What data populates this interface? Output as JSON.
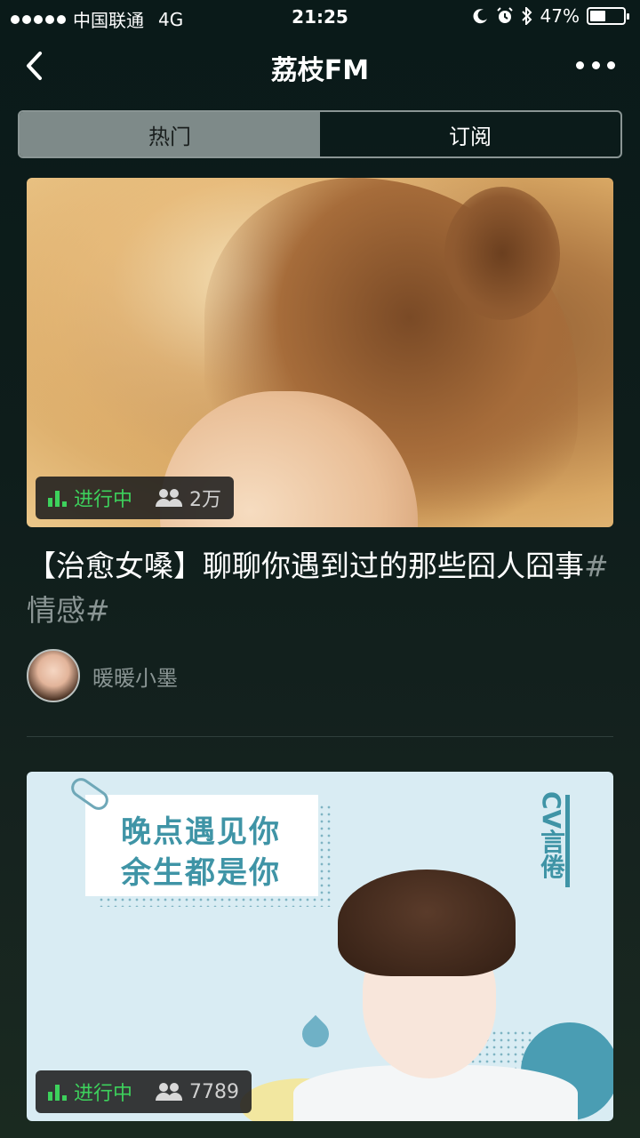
{
  "status_bar": {
    "carrier": "中国联通",
    "network": "4G",
    "time": "21:25",
    "battery": "47%",
    "battery_level": 0.47
  },
  "nav": {
    "title": "荔枝FM"
  },
  "tabs": [
    {
      "label": "热门",
      "active": true
    },
    {
      "label": "订阅",
      "active": false
    }
  ],
  "cards": [
    {
      "status": "进行中",
      "count": "2万",
      "title_main": "【治愈女嗓】聊聊你遇到过的那些囧人囧事",
      "title_tag": "#情感#",
      "author": "暖暖小墨"
    },
    {
      "image_text": {
        "line1": "晚点遇见你",
        "line2": "余生都是你",
        "side": "CV言倦"
      },
      "status": "进行中",
      "count": "7789"
    }
  ],
  "colors": {
    "accent_green": "#3dd15c",
    "teal": "#3f94a6",
    "muted": "#8a9594"
  }
}
